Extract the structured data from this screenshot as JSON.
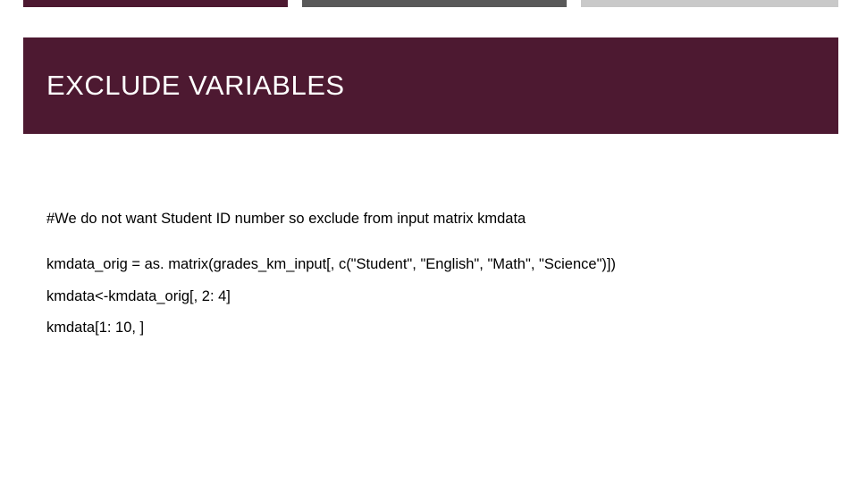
{
  "slide": {
    "title": "EXCLUDE VARIABLES",
    "lines": [
      "#We do not want Student ID number so exclude from input matrix kmdata",
      "kmdata_orig = as. matrix(grades_km_input[, c(\"Student\", \"English\", \"Math\", \"Science\")])",
      "kmdata<-kmdata_orig[, 2: 4]",
      "kmdata[1: 10, ]"
    ]
  }
}
